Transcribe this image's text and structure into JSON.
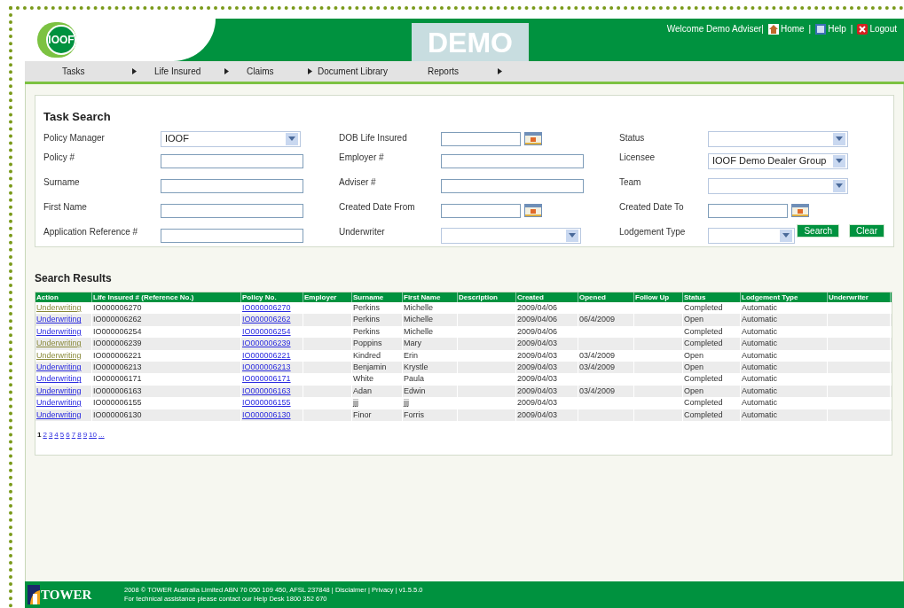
{
  "header": {
    "logo_text": "IOOF",
    "banner": "DEMO",
    "welcome": "Welcome Demo Adviser|",
    "separator": "|",
    "links": [
      {
        "label": "Home"
      },
      {
        "label": "Help"
      },
      {
        "label": "Logout"
      }
    ]
  },
  "nav": [
    {
      "label": "Tasks",
      "has_submenu": true
    },
    {
      "label": "Life Insured",
      "has_submenu": true
    },
    {
      "label": "Claims",
      "has_submenu": true
    },
    {
      "label": "Document Library",
      "has_submenu": false
    },
    {
      "label": "Reports",
      "has_submenu": true
    }
  ],
  "task_search": {
    "title": "Task Search",
    "fields": [
      {
        "label": "Policy Manager",
        "kind": "select",
        "value": "IOOF"
      },
      {
        "label": "DOB Life Insured",
        "kind": "date"
      },
      {
        "label": "Status",
        "kind": "select"
      },
      {
        "label": "Policy #",
        "kind": "text"
      },
      {
        "label": "Employer #",
        "kind": "text"
      },
      {
        "label": "Licensee",
        "kind": "select",
        "value": "IOOF Demo Dealer Group"
      },
      {
        "label": "Surname",
        "kind": "text"
      },
      {
        "label": "Adviser #",
        "kind": "text"
      },
      {
        "label": "Team",
        "kind": "select"
      },
      {
        "label": "First Name",
        "kind": "text"
      },
      {
        "label": "Created Date From",
        "kind": "date"
      },
      {
        "label": "Created Date To",
        "kind": "date"
      },
      {
        "label": "Application Reference #",
        "kind": "text"
      },
      {
        "label": "Underwriter",
        "kind": "select"
      },
      {
        "label": "Lodgement Type",
        "kind": "small_select"
      }
    ],
    "buttons": [
      "Search",
      "Clear"
    ]
  },
  "results": {
    "title": "Search Results",
    "columns": [
      "Action",
      "Life Insured # (Reference No.)",
      "Policy No.",
      "Employer",
      "Surname",
      "First Name",
      "Description",
      "Created",
      "Opened",
      "Follow Up",
      "Status",
      "Lodgement Type",
      "Underwriter"
    ],
    "rows": [
      {
        "action": "Underwriting",
        "visited": true,
        "life_insured": "IO000006270",
        "policy": "IO000006270",
        "surname": "Perkins",
        "first_name": "Michelle",
        "created": "2009/04/06",
        "opened": "",
        "status": "Completed",
        "lodgement": "Automatic"
      },
      {
        "action": "Underwriting",
        "visited": false,
        "life_insured": "IO000006262",
        "policy": "IO000006262",
        "surname": "Perkins",
        "first_name": "Michelle",
        "created": "2009/04/06",
        "opened": "06/4/2009",
        "status": "Open",
        "lodgement": "Automatic"
      },
      {
        "action": "Underwriting",
        "visited": false,
        "life_insured": "IO000006254",
        "policy": "IO000006254",
        "surname": "Perkins",
        "first_name": "Michelle",
        "created": "2009/04/06",
        "opened": "",
        "status": "Completed",
        "lodgement": "Automatic"
      },
      {
        "action": "Underwriting",
        "visited": true,
        "life_insured": "IO000006239",
        "policy": "IO000006239",
        "surname": "Poppins",
        "first_name": "Mary",
        "created": "2009/04/03",
        "opened": "",
        "status": "Completed",
        "lodgement": "Automatic"
      },
      {
        "action": "Underwriting",
        "visited": true,
        "life_insured": "IO000006221",
        "policy": "IO000006221",
        "surname": "Kindred",
        "first_name": "Erin",
        "created": "2009/04/03",
        "opened": "03/4/2009",
        "status": "Open",
        "lodgement": "Automatic"
      },
      {
        "action": "Underwriting",
        "visited": false,
        "life_insured": "IO000006213",
        "policy": "IO000006213",
        "surname": "Benjamin",
        "first_name": "Krystle",
        "created": "2009/04/03",
        "opened": "03/4/2009",
        "status": "Open",
        "lodgement": "Automatic"
      },
      {
        "action": "Underwriting",
        "visited": false,
        "life_insured": "IO000006171",
        "policy": "IO000006171",
        "surname": "White",
        "first_name": "Paula",
        "created": "2009/04/03",
        "opened": "",
        "status": "Completed",
        "lodgement": "Automatic"
      },
      {
        "action": "Underwriting",
        "visited": false,
        "life_insured": "IO000006163",
        "policy": "IO000006163",
        "surname": "Adan",
        "first_name": "Edwin",
        "created": "2009/04/03",
        "opened": "03/4/2009",
        "status": "Open",
        "lodgement": "Automatic"
      },
      {
        "action": "Underwriting",
        "visited": false,
        "life_insured": "IO000006155",
        "policy": "IO000006155",
        "surname": "jjj",
        "first_name": "jjj",
        "created": "2009/04/03",
        "opened": "",
        "status": "Completed",
        "lodgement": "Automatic"
      },
      {
        "action": "Underwriting",
        "visited": false,
        "life_insured": "IO000006130",
        "policy": "IO000006130",
        "surname": "Finor",
        "first_name": "Forris",
        "created": "2009/04/03",
        "opened": "",
        "status": "Completed",
        "lodgement": "Automatic"
      }
    ],
    "pages": [
      {
        "label": "1",
        "selected": true
      },
      {
        "label": "2",
        "selected": false
      },
      {
        "label": "3",
        "selected": false
      },
      {
        "label": "4",
        "selected": false
      },
      {
        "label": "5",
        "selected": false
      },
      {
        "label": "6",
        "selected": false
      },
      {
        "label": "7",
        "selected": false
      },
      {
        "label": "8",
        "selected": false
      },
      {
        "label": "9",
        "selected": false
      },
      {
        "label": "10",
        "selected": false
      },
      {
        "label": "...",
        "selected": false
      }
    ]
  },
  "footer": {
    "brand": "TOWER",
    "copyright": "2008 © TOWER Australia Limited ABN 70 050 109 450, AFSL 237848 | Disclaimer | Privacy | v1.5.5.0",
    "help": "For technical assistance please contact our Help Desk 1800 352 670"
  }
}
